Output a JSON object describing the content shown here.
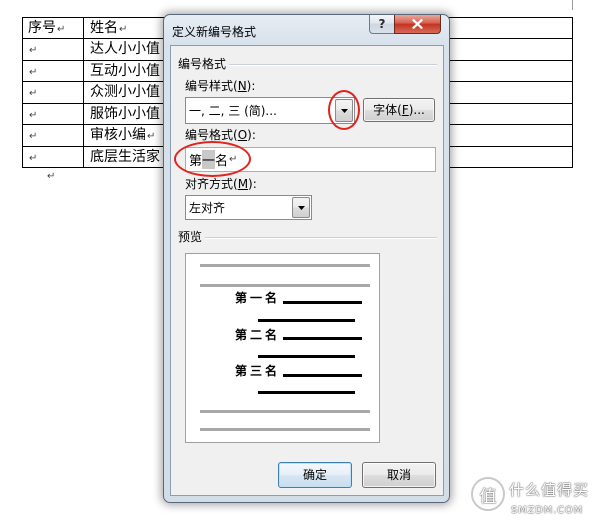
{
  "document": {
    "table": {
      "headers": [
        {
          "text": "序号",
          "mark": "↵"
        },
        {
          "text": "姓名",
          "mark": "↵"
        }
      ],
      "rows": [
        {
          "index_mark": "↵",
          "name": "达人小小值"
        },
        {
          "index_mark": "↵",
          "name": "互动小小值"
        },
        {
          "index_mark": "↵",
          "name": "众测小小值"
        },
        {
          "index_mark": "↵",
          "name": "服饰小小值"
        },
        {
          "index_mark": "↵",
          "name": "审核小编",
          "mark": "↵"
        },
        {
          "index_mark": "↵",
          "name": "底层生活家"
        }
      ]
    },
    "trailing_paragraph_mark": "↵"
  },
  "dialog": {
    "title": "定义新编号格式",
    "help_label": "?",
    "number_format_group": "编号格式",
    "number_style": {
      "label_pre": "编号样式(",
      "label_key": "N",
      "label_post": "):",
      "value": "一, 二, 三 (简)..."
    },
    "font_button": {
      "label_pre": "字体(",
      "label_key": "F",
      "label_post": ")..."
    },
    "number_format": {
      "label_pre": "编号格式(",
      "label_key": "O",
      "label_post": "):",
      "prefix": "第",
      "number": "一",
      "suffix": "名",
      "mark": "↵"
    },
    "alignment": {
      "label_pre": "对齐方式(",
      "label_key": "M",
      "label_post": "):",
      "value": "左对齐"
    },
    "preview_group": "预览",
    "preview_levels": [
      "第一名",
      "第二名",
      "第三名"
    ],
    "ok_label": "确定",
    "cancel_label": "取消"
  },
  "watermark": {
    "logo": "值",
    "name": "什么值得买",
    "site": "SMZDM.COM"
  },
  "colors": {
    "annotation": "#e0231f",
    "client_bg": "#f0f0f0",
    "default_button_border": "#3c7fb1"
  },
  "icons": {
    "help": "help-icon",
    "close": "close-icon",
    "dropdown": "chevron-down-icon"
  }
}
